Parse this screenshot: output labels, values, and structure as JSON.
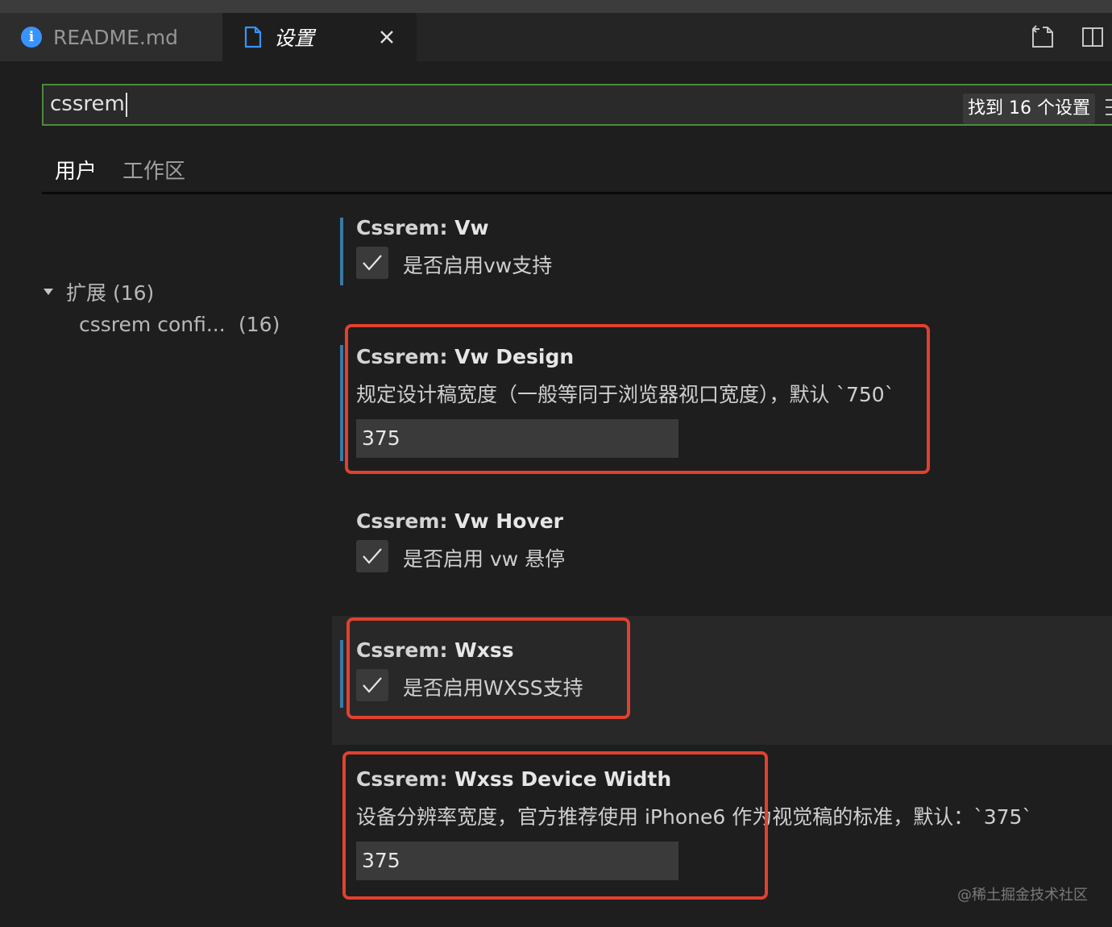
{
  "tabs": [
    {
      "label": "README.md",
      "icon": "info-icon"
    },
    {
      "label": "设置",
      "icon": "file-icon",
      "active": true
    }
  ],
  "search": {
    "value": "cssrem",
    "result_count": "找到 16 个设置"
  },
  "scopes": {
    "user": "用户",
    "workspace": "工作区"
  },
  "toc": {
    "extensions": "扩展 (16)",
    "child": "cssrem confi...",
    "child_count": "(16)"
  },
  "settings": [
    {
      "category": "Cssrem: ",
      "name": "Vw",
      "type": "checkbox",
      "checked": true,
      "label": "是否启用vw支持"
    },
    {
      "category": "Cssrem: ",
      "name": "Vw Design",
      "type": "number",
      "description": "规定设计稿宽度（一般等同于浏览器视口宽度），默认 `750`",
      "value": "375"
    },
    {
      "category": "Cssrem: ",
      "name": "Vw Hover",
      "type": "checkbox",
      "checked": true,
      "label": "是否启用 vw 悬停"
    },
    {
      "category": "Cssrem: ",
      "name": "Wxss",
      "type": "checkbox",
      "checked": true,
      "label": "是否启用WXSS支持"
    },
    {
      "category": "Cssrem: ",
      "name": "Wxss Device Width",
      "type": "number",
      "description": "设备分辨率宽度，官方推荐使用 iPhone6 作为视觉稿的标准，默认：`375`",
      "value": "375"
    }
  ],
  "watermark": "@稀土掘金技术社区",
  "colors": {
    "accent": "#3794ff",
    "highlight": "#e0412f",
    "search_border": "#4d8a3f",
    "modified_bar": "#3a79a8"
  }
}
